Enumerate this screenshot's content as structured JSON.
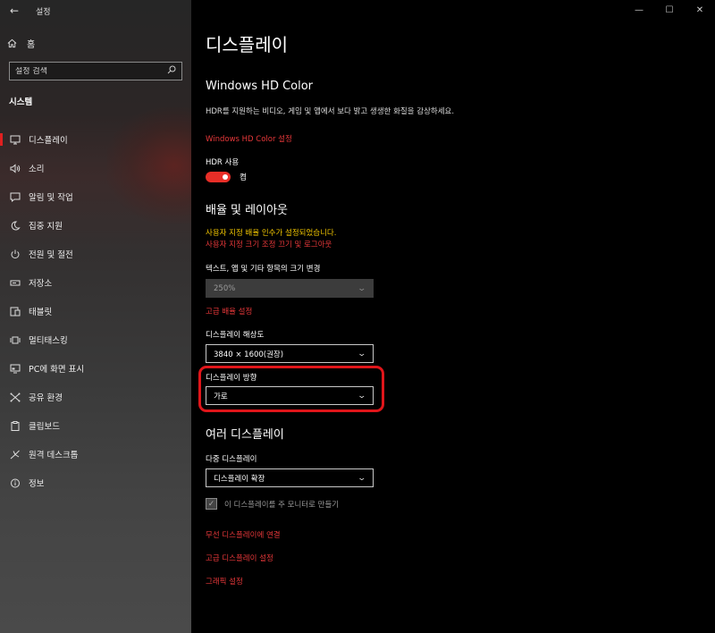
{
  "window": {
    "app_title": "설정",
    "controls": {
      "minimize": "—",
      "maximize": "☐",
      "close": "✕"
    }
  },
  "sidebar": {
    "home": "홈",
    "search_placeholder": "설정 검색",
    "section": "시스템",
    "items": [
      {
        "label": "디스플레이",
        "icon": "monitor-icon",
        "active": true
      },
      {
        "label": "소리",
        "icon": "speaker-icon"
      },
      {
        "label": "알림 및 작업",
        "icon": "notification-icon"
      },
      {
        "label": "집중 지원",
        "icon": "moon-icon"
      },
      {
        "label": "전원 및 절전",
        "icon": "power-icon"
      },
      {
        "label": "저장소",
        "icon": "storage-icon"
      },
      {
        "label": "태블릿",
        "icon": "tablet-icon"
      },
      {
        "label": "멀티태스킹",
        "icon": "multitasking-icon"
      },
      {
        "label": "PC에 화면 표시",
        "icon": "project-icon"
      },
      {
        "label": "공유 환경",
        "icon": "shared-icon"
      },
      {
        "label": "클립보드",
        "icon": "clipboard-icon"
      },
      {
        "label": "원격 데스크톱",
        "icon": "remote-desktop-icon"
      },
      {
        "label": "정보",
        "icon": "info-icon"
      }
    ]
  },
  "main": {
    "title": "디스플레이",
    "hdr": {
      "heading": "Windows HD Color",
      "description": "HDR를 지원하는 비디오, 게임 및 앱에서 보다 밝고 생생한 화질을 감상하세요.",
      "link": "Windows HD Color 설정",
      "toggle_label": "HDR 사용",
      "toggle_state": "켬"
    },
    "scale": {
      "heading": "배율 및 레이아웃",
      "warning_yellow": "사용자 지정 배율 인수가 설정되었습니다.",
      "warning_red": "사용자 지정 크기 조정 끄기 및 로그아웃",
      "size_label": "텍스트, 앱 및 기타 항목의 크기 변경",
      "size_value": "250%",
      "advanced_link": "고급 배율 설정",
      "resolution_label": "디스플레이 해상도",
      "resolution_value": "3840 × 1600(권장)",
      "orientation_label": "디스플레이 방향",
      "orientation_value": "가로"
    },
    "multi": {
      "heading": "여러 디스플레이",
      "multi_label": "다중 디스플레이",
      "multi_value": "디스플레이 확장",
      "main_monitor_checkbox": "이 디스플레이를 주 모니터로 만들기",
      "links": [
        "무선 디스플레이에 연결",
        "고급 디스플레이 설정",
        "그래픽 설정"
      ]
    }
  },
  "colors": {
    "accent_red": "#e8383a",
    "warning_yellow": "#f0c400",
    "toggle_on": "#e82e27",
    "highlight_border": "#e0151a"
  }
}
